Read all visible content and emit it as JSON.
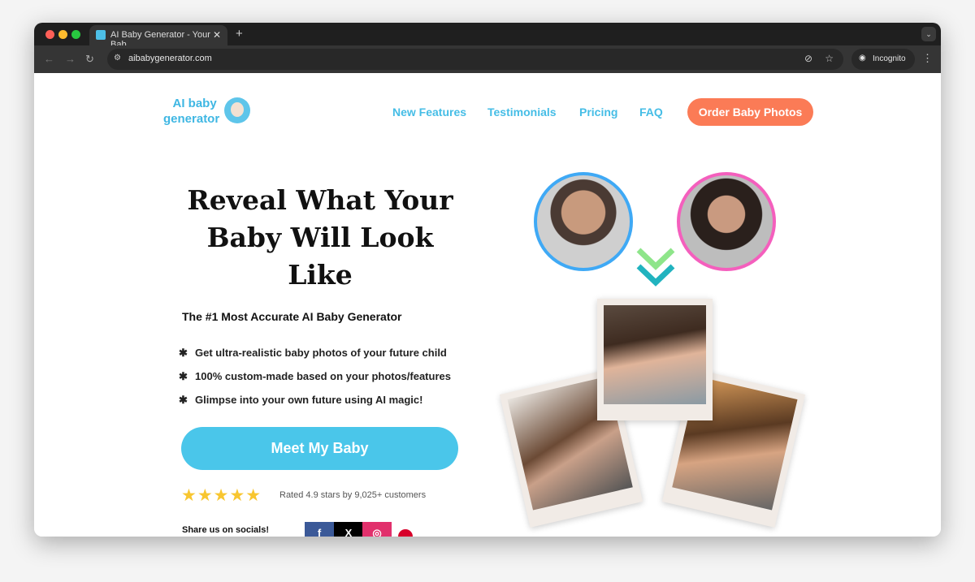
{
  "browser": {
    "tab_title": "AI Baby Generator - Your Bab",
    "url": "aibabygenerator.com",
    "profile": "Incognito"
  },
  "header": {
    "logo_line1": "AI baby",
    "logo_line2": "generator",
    "nav": [
      "New Features",
      "Testimonials",
      "Pricing",
      "FAQ"
    ],
    "cta": "Order Baby Photos"
  },
  "hero": {
    "title": "Reveal What Your Baby Will Look Like",
    "subtitle": "The #1 Most Accurate AI Baby Generator",
    "bullets": [
      "Get ultra-realistic baby photos of your future child",
      "100% custom-made based on your photos/features",
      "Glimpse into your own future using AI magic!"
    ],
    "cta": "Meet My Baby",
    "stars": "★★★★★",
    "rating": "Rated 4.9 stars by 9,025+ customers",
    "share_label": "Share us on socials!",
    "social": [
      "f",
      "X",
      "◎"
    ]
  },
  "colors": {
    "accent": "#4ac6ea",
    "order": "#fb7b56",
    "stars": "#f8c630",
    "father_ring": "#3fa9f5",
    "mother_ring": "#f45fbd"
  }
}
